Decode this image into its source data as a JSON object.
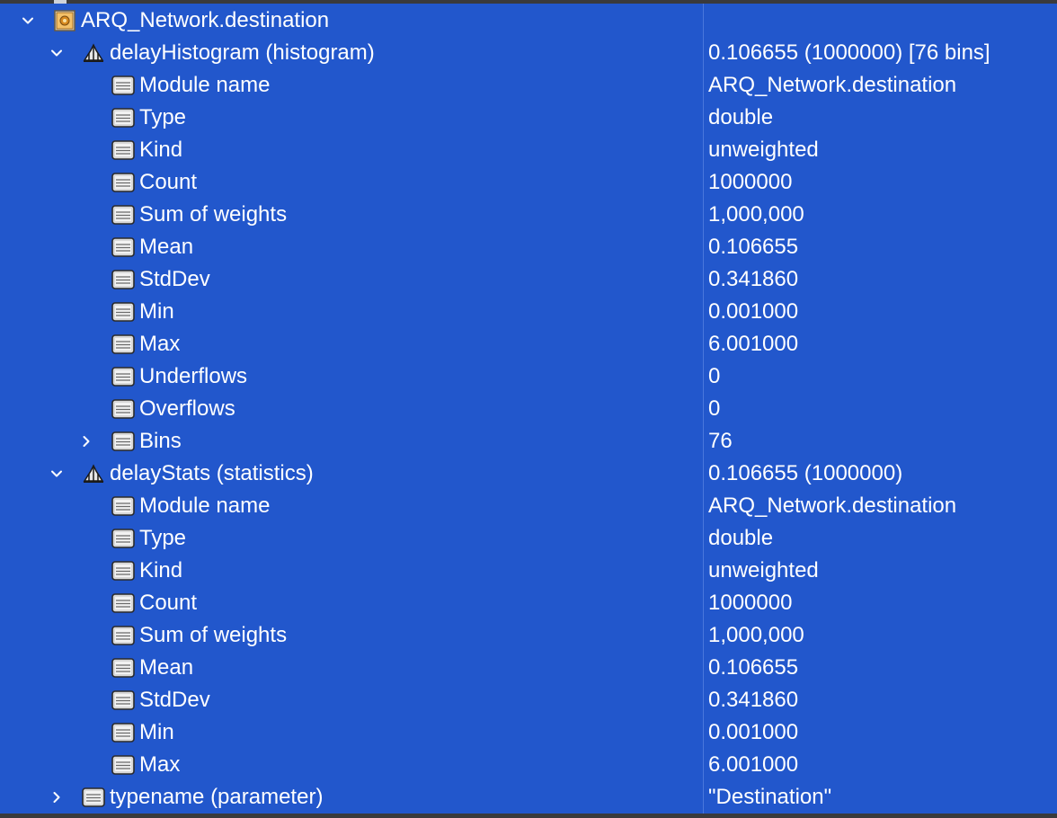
{
  "tree": {
    "root": {
      "label": "ARQ_Network.destination",
      "value": "",
      "icon": "module-icon",
      "expanded": true
    },
    "groups": [
      {
        "label": "delayHistogram (histogram)",
        "value": "0.106655 (1000000) [76 bins]",
        "icon": "histogram-icon",
        "expanded": true,
        "fields": [
          {
            "label": "Module name",
            "value": "ARQ_Network.destination"
          },
          {
            "label": "Type",
            "value": "double"
          },
          {
            "label": "Kind",
            "value": "unweighted"
          },
          {
            "label": "Count",
            "value": "1000000"
          },
          {
            "label": "Sum of weights",
            "value": "1,000,000"
          },
          {
            "label": "Mean",
            "value": "0.106655"
          },
          {
            "label": "StdDev",
            "value": "0.341860"
          },
          {
            "label": "Min",
            "value": "0.001000"
          },
          {
            "label": "Max",
            "value": "6.001000"
          },
          {
            "label": "Underflows",
            "value": "0"
          },
          {
            "label": "Overflows",
            "value": "0"
          },
          {
            "label": "Bins",
            "value": "76",
            "expandable": true
          }
        ]
      },
      {
        "label": "delayStats (statistics)",
        "value": "0.106655 (1000000)",
        "icon": "statistics-icon",
        "expanded": true,
        "fields": [
          {
            "label": "Module name",
            "value": "ARQ_Network.destination"
          },
          {
            "label": "Type",
            "value": "double"
          },
          {
            "label": "Kind",
            "value": "unweighted"
          },
          {
            "label": "Count",
            "value": "1000000"
          },
          {
            "label": "Sum of weights",
            "value": "1,000,000"
          },
          {
            "label": "Mean",
            "value": "0.106655"
          },
          {
            "label": "StdDev",
            "value": "0.341860"
          },
          {
            "label": "Min",
            "value": "0.001000"
          },
          {
            "label": "Max",
            "value": "6.001000"
          }
        ]
      }
    ],
    "tail": {
      "label": "typename (parameter)",
      "value": "\"Destination\"",
      "icon": "parameter-icon",
      "expanded": false
    }
  },
  "colors": {
    "selection_background": "#2257cc",
    "text": "#ffffff",
    "chrome": "#3a3a3c"
  }
}
